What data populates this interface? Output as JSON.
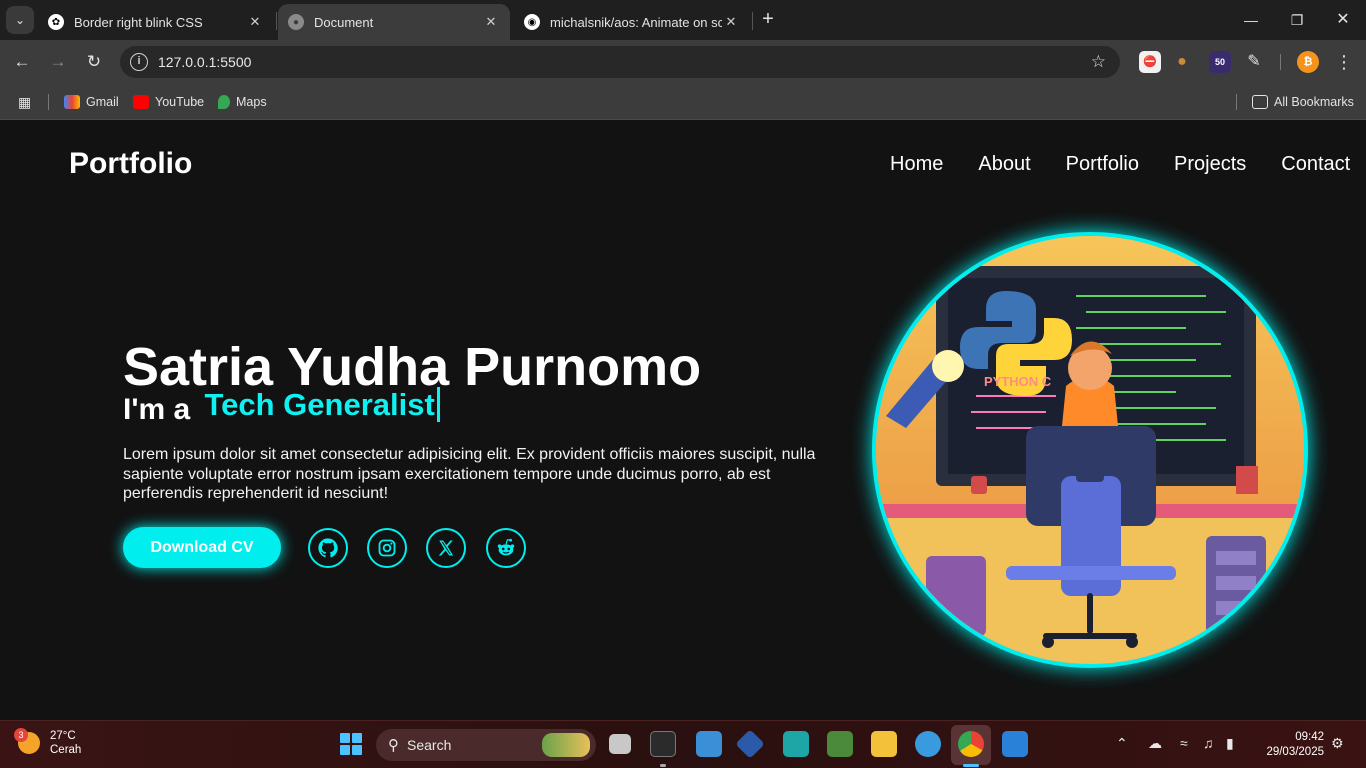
{
  "browser": {
    "tabs": [
      {
        "title": "Border right blink CSS",
        "icon": "chatgpt-icon"
      },
      {
        "title": "Document",
        "icon": "globe-icon"
      },
      {
        "title": "michalsnik/aos: Animate on scroll",
        "icon": "github-icon"
      }
    ],
    "url": "127.0.0.1:5500",
    "extension_badge": "50",
    "bookmarks": [
      {
        "label": "Gmail",
        "icon": "gmail-icon"
      },
      {
        "label": "YouTube",
        "icon": "youtube-icon"
      },
      {
        "label": "Maps",
        "icon": "maps-icon"
      }
    ],
    "all_bookmarks": "All Bookmarks"
  },
  "site": {
    "logo": "Portfolio",
    "nav": [
      "Home",
      "About",
      "Portfolio",
      "Projects",
      "Contact"
    ],
    "hero": {
      "name": "Satria Yudha Purnomo",
      "role_prefix": "I'm a",
      "role_typed": "Tech Generalist",
      "description": "Lorem ipsum dolor sit amet consectetur adipisicing elit. Ex provident officiis maiores suscipit, nulla sapiente voluptate error nostrum ipsam exercitationem tempore unde ducimus porro, ab est perferendis reprehenderit id nesciunt!",
      "cta": "Download CV",
      "socials": [
        "github-icon",
        "instagram-icon",
        "x-icon",
        "reddit-icon"
      ],
      "illustration_label": "PYTHON C",
      "accent": "#00eeee"
    }
  },
  "taskbar": {
    "weather": {
      "badge": "3",
      "temp": "27°C",
      "condition": "Cerah"
    },
    "search": "Search",
    "time": "09:42",
    "date": "29/03/2025"
  }
}
